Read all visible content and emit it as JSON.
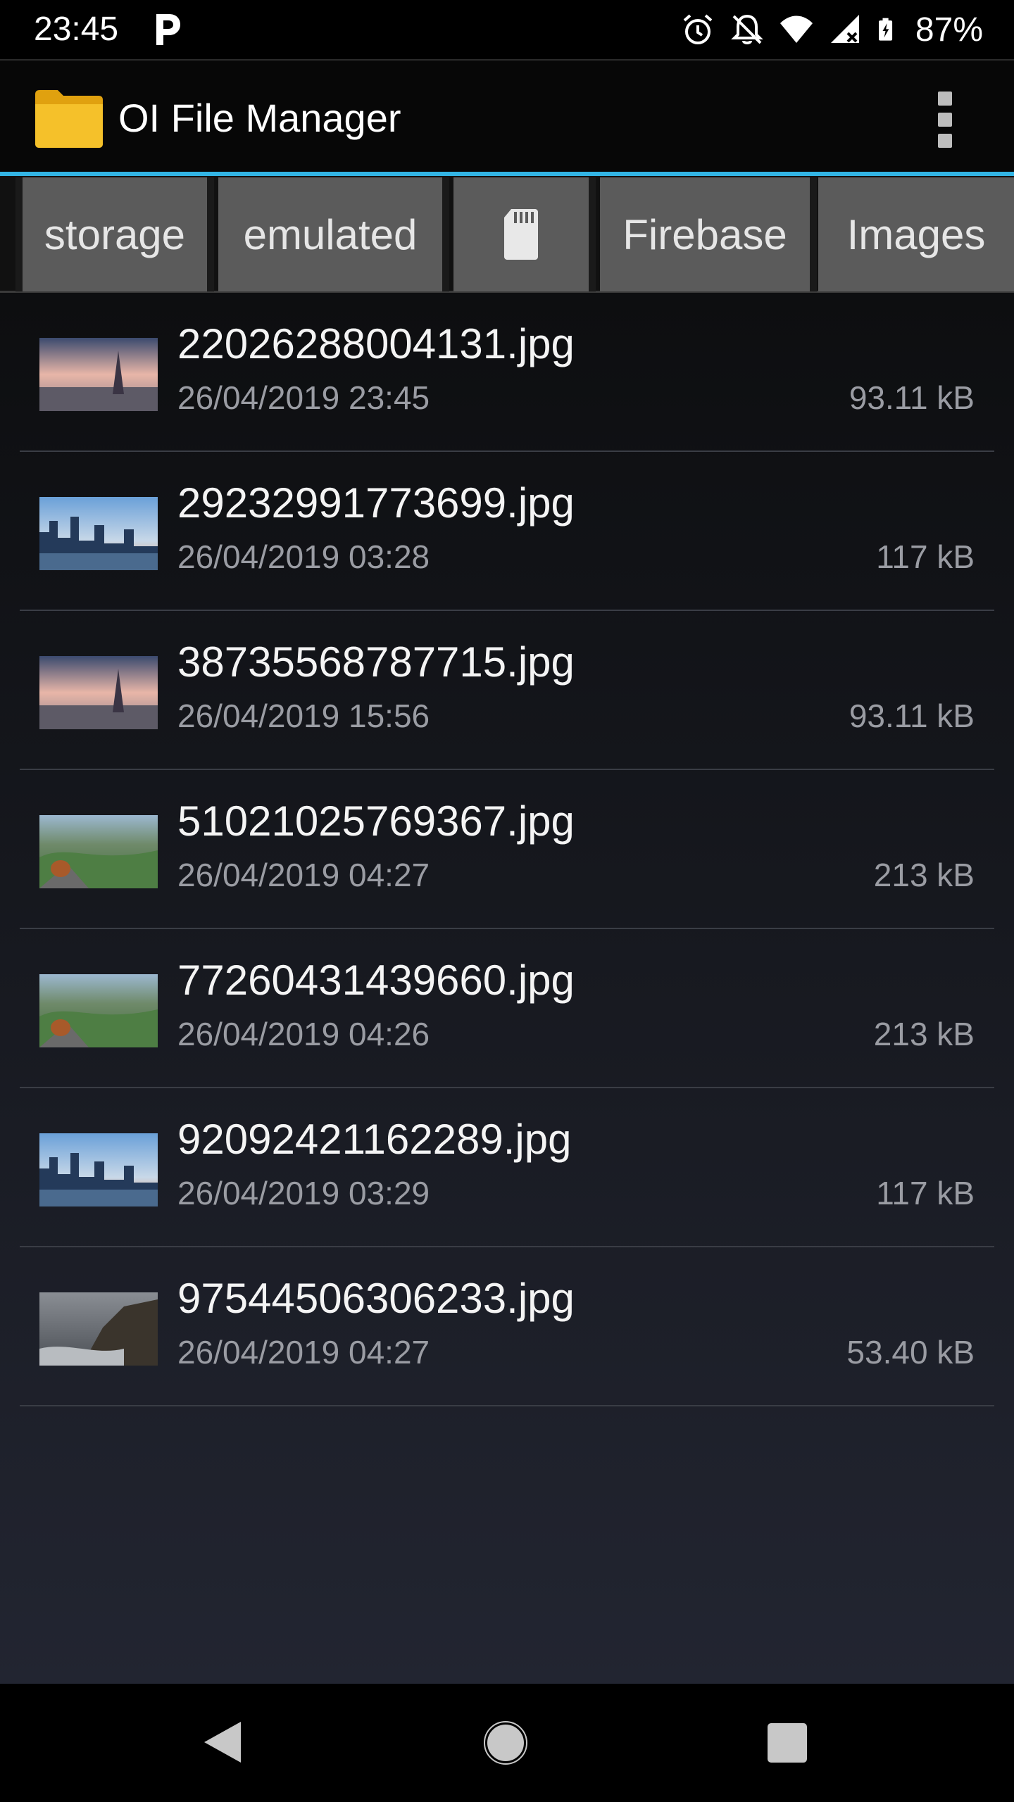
{
  "status_bar": {
    "time": "23:45",
    "battery": "87%",
    "icons": [
      "parking-icon",
      "alarm-icon",
      "notifications-off-icon",
      "wifi-icon",
      "signal-icon",
      "battery-icon"
    ]
  },
  "app_bar": {
    "title": "OI File Manager",
    "icon": "folder-icon",
    "menu_icon": "overflow-menu-icon",
    "accent_color": "#33b5e5"
  },
  "path": {
    "crumbs": [
      "storage",
      "emulated",
      "",
      "Firebase",
      "Images"
    ],
    "crumb_icons": [
      "",
      "",
      "sd-card-icon",
      "",
      ""
    ]
  },
  "files": [
    {
      "name": "22026288004131.jpg",
      "date": "26/04/2019 23:45",
      "size": "93.11 kB",
      "thumb": "paris"
    },
    {
      "name": "29232991773699.jpg",
      "date": "26/04/2019 03:28",
      "size": "117 kB",
      "thumb": "city"
    },
    {
      "name": "38735568787715.jpg",
      "date": "26/04/2019 15:56",
      "size": "93.11 kB",
      "thumb": "paris"
    },
    {
      "name": "51021025769367.jpg",
      "date": "26/04/2019 04:27",
      "size": "213 kB",
      "thumb": "squirrel"
    },
    {
      "name": "77260431439660.jpg",
      "date": "26/04/2019 04:26",
      "size": "213 kB",
      "thumb": "squirrel"
    },
    {
      "name": "92092421162289.jpg",
      "date": "26/04/2019 03:29",
      "size": "117 kB",
      "thumb": "city"
    },
    {
      "name": "97544506306233.jpg",
      "date": "26/04/2019 04:27",
      "size": "53.40 kB",
      "thumb": "coast"
    }
  ],
  "nav_bar": {
    "icons": [
      "back-icon",
      "home-icon",
      "recents-icon"
    ]
  }
}
